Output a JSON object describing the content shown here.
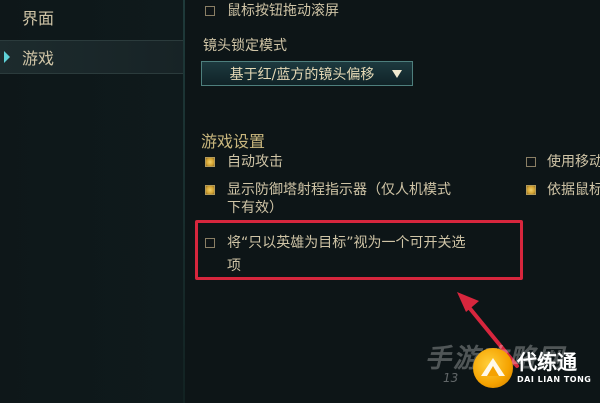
{
  "sidebar": {
    "items": [
      {
        "label": "界面",
        "active": false
      },
      {
        "label": "游戏",
        "active": true
      }
    ]
  },
  "top_option": {
    "label": "鼠标按钮拖动滚屏",
    "checked": false
  },
  "camera_lock": {
    "heading": "镜头锁定模式",
    "selected": "基于红/蓝方的镜头偏移"
  },
  "game_settings": {
    "title": "游戏设置",
    "left": [
      {
        "label": "自动攻击",
        "checked": true
      },
      {
        "label_lines": [
          "显示防御塔射程指示器（仅人机模式",
          "下有效）"
        ],
        "checked": true
      },
      {
        "label_lines": [
          "将“只以英雄为目标”视为一个可开关选",
          "项"
        ],
        "checked": false
      }
    ],
    "right": [
      {
        "label": "使用移动",
        "checked": false
      },
      {
        "label": "依据鼠标",
        "checked": true
      }
    ]
  },
  "watermark": {
    "text": "手游攻略网",
    "sub": "13"
  },
  "brand": {
    "title": "代练通",
    "subtitle": "DAI LIAN TONG"
  },
  "colors": {
    "highlight": "#d7263d",
    "checkbox_checked": "#d5a432",
    "accent": "#5fd2d8"
  }
}
